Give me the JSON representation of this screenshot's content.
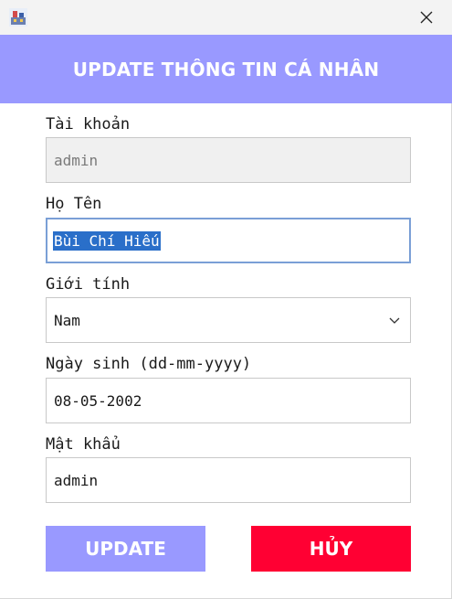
{
  "header": {
    "title": "UPDATE THÔNG TIN CÁ NHÂN"
  },
  "form": {
    "account": {
      "label": "Tài khoản",
      "value": "admin"
    },
    "fullname": {
      "label": "Họ Tên",
      "value": "Bùi Chí Hiếu"
    },
    "gender": {
      "label": "Giới tính",
      "value": "Nam"
    },
    "birthday": {
      "label": "Ngày sinh (dd-mm-yyyy)",
      "value": "08-05-2002"
    },
    "password": {
      "label": "Mật khẩu",
      "value": "admin"
    }
  },
  "buttons": {
    "update_label": "UPDATE",
    "cancel_label": "HỦY"
  },
  "colors": {
    "accent": "#9999ff",
    "danger": "#ff0033",
    "selection": "#2a6fc9"
  },
  "icons": {
    "app": "app-icon",
    "close": "close-icon",
    "dropdown": "chevron-down-icon"
  }
}
